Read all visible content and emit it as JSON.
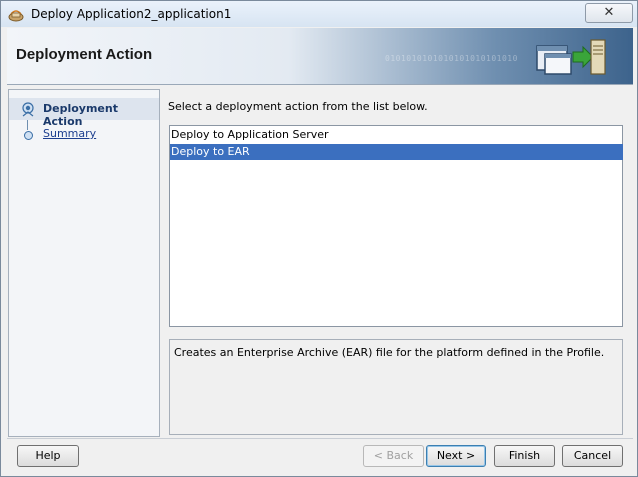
{
  "window": {
    "title": "Deploy Application2_application1",
    "close_glyph": "✕"
  },
  "header": {
    "title": "Deployment Action",
    "binary_decoration": "0101010101010101010101010"
  },
  "nav": {
    "items": [
      {
        "label": "Deployment Action",
        "state": "active"
      },
      {
        "label": "Summary",
        "state": "link"
      }
    ]
  },
  "main": {
    "instruction": "Select a deployment action from the list below.",
    "actions": [
      {
        "label": "Deploy to Application Server",
        "selected": false
      },
      {
        "label": "Deploy to EAR",
        "selected": true
      }
    ],
    "description": "Creates an Enterprise Archive (EAR) file for the platform defined in the Profile."
  },
  "buttons": {
    "help": "Help",
    "back": "< Back",
    "next": "Next >",
    "finish": "Finish",
    "cancel": "Cancel"
  },
  "colors": {
    "selection": "#3b6fbf",
    "link": "#1d3f8f",
    "header_accent": "#3d638c"
  }
}
